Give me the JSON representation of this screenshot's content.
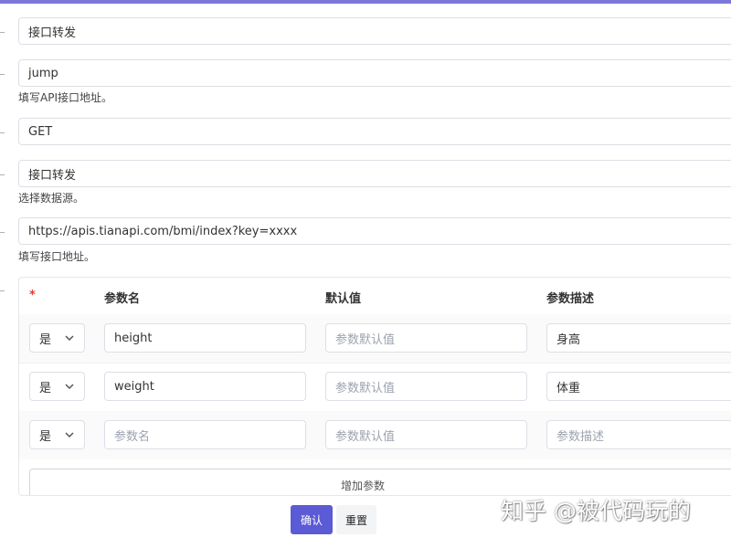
{
  "form": {
    "name_value": "接口转发",
    "path_value": "jump",
    "path_hint": "填写API接口地址。",
    "method_value": "GET",
    "source_value": "接口转发",
    "source_hint": "选择数据源。",
    "url_value": "https://apis.tianapi.com/bmi/index?key=xxxx",
    "url_hint": "填写接口地址。"
  },
  "params": {
    "required_marker": "*",
    "headers": [
      "参数名",
      "默认值",
      "参数描述"
    ],
    "rows": [
      {
        "required": "是",
        "name": "height",
        "default": "参数默认值",
        "desc": "身高"
      },
      {
        "required": "是",
        "name": "weight",
        "default": "参数默认值",
        "desc": "体重"
      },
      {
        "required": "是",
        "name": "参数名",
        "default": "参数默认值",
        "desc": "参数描述"
      }
    ],
    "add_label": "增加参数"
  },
  "actions": {
    "confirm_label": "确认",
    "reset_label": "重置",
    "confirm_color": "#5b5bd6"
  },
  "watermark": "知乎 @被代码玩的"
}
